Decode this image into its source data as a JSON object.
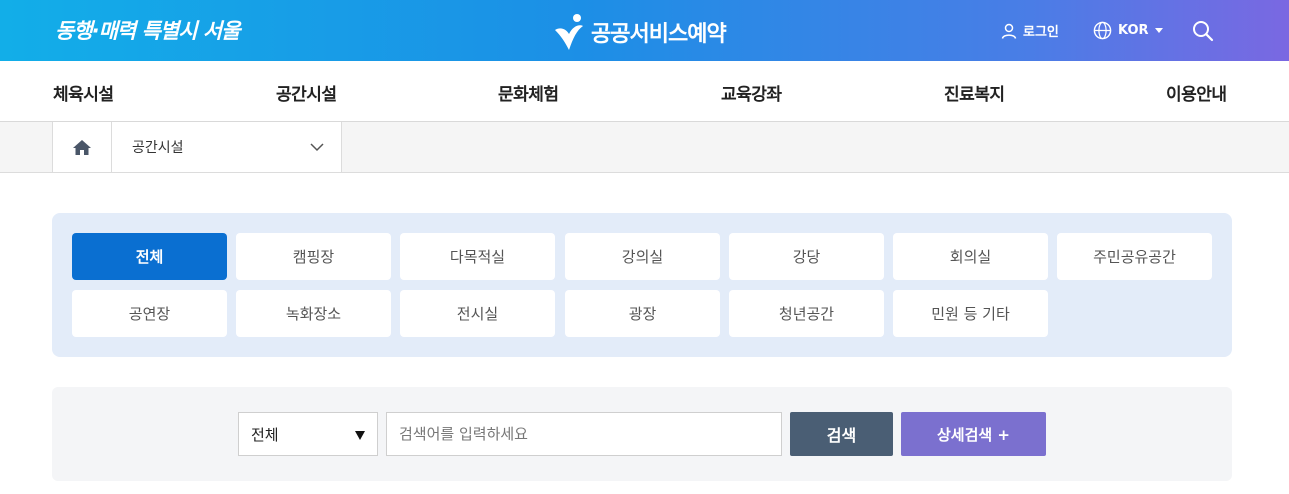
{
  "header": {
    "slogan": "동행·매력 특별시 서울",
    "logo_text": "공공서비스예약",
    "login_label": "로그인",
    "lang_label": "KOR"
  },
  "gnb": {
    "items": [
      "체육시설",
      "공간시설",
      "문화체험",
      "교육강좌",
      "진료복지",
      "이용안내"
    ]
  },
  "breadcrumb": {
    "current": "공간시설"
  },
  "categories": {
    "row1": [
      "전체",
      "캠핑장",
      "다목적실",
      "강의실",
      "강당",
      "회의실",
      "주민공유공간"
    ],
    "row2": [
      "공연장",
      "녹화장소",
      "전시실",
      "광장",
      "청년공간",
      "민원 등 기타"
    ],
    "active": "전체"
  },
  "search": {
    "scope_value": "전체",
    "placeholder": "검색어를 입력하세요",
    "search_label": "검색",
    "advanced_label": "상세검색 +"
  },
  "colors": {
    "active_category": "#0a6fd1",
    "search_button": "#4a5e74",
    "advanced_button": "#7b70cf",
    "category_panel": "#e3ecf9"
  }
}
